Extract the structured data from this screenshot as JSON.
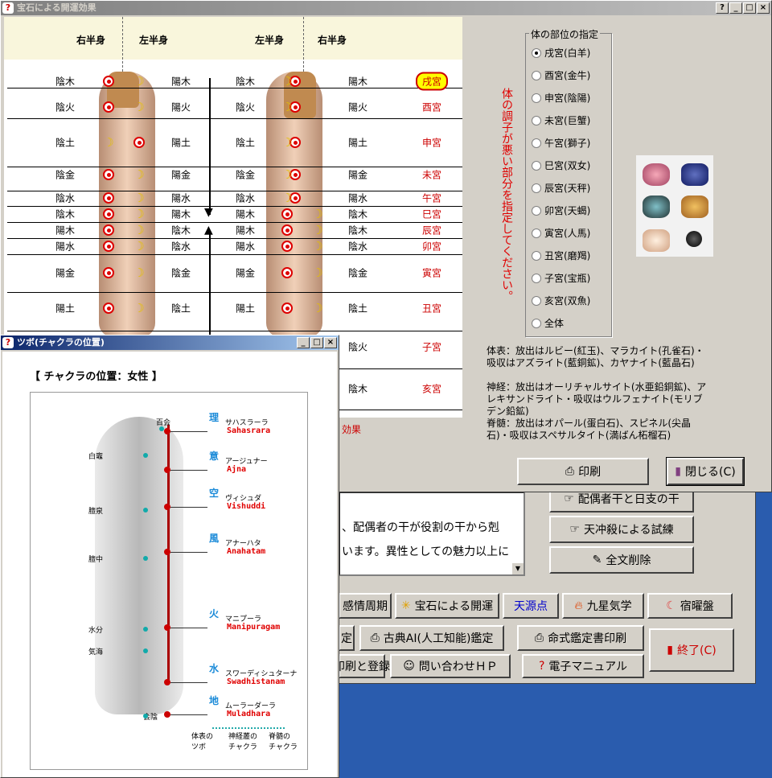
{
  "main": {
    "title": "宝石による開運効果",
    "close_label": "閉じる(C)",
    "print_label": "印刷"
  },
  "chart": {
    "headers": [
      "右半身",
      "左半身",
      "左半身",
      "右半身"
    ],
    "rows": [
      {
        "a": "陰木",
        "b": "陽木",
        "c": "陰木",
        "d": "陽木",
        "p": "戌宮"
      },
      {
        "a": "陰火",
        "b": "陽火",
        "c": "陰火",
        "d": "陽火",
        "p": "酉宮"
      },
      {
        "a": "陰土",
        "b": "陽土",
        "c": "陰土",
        "d": "陽土",
        "p": "申宮"
      },
      {
        "a": "陰金",
        "b": "陽金",
        "c": "陰金",
        "d": "陽金",
        "p": "未宮"
      },
      {
        "a": "陰水",
        "b": "陽水",
        "c": "陰水",
        "d": "陽水",
        "p": "午宮"
      },
      {
        "a": "陰木",
        "b": "陽木",
        "c": "陽木",
        "d": "陰木",
        "p": "巳宮"
      },
      {
        "a": "陽木",
        "b": "陰木",
        "c": "陽木",
        "d": "陰木",
        "p": "辰宮"
      },
      {
        "a": "陽水",
        "b": "陰水",
        "c": "陽水",
        "d": "陰水",
        "p": "卯宮"
      },
      {
        "a": "陽金",
        "b": "陰金",
        "c": "陽金",
        "d": "陰金",
        "p": "寅宮"
      },
      {
        "a": "陽土",
        "b": "陰土",
        "c": "陽土",
        "d": "陰土",
        "p": "丑宮"
      },
      {
        "a": "",
        "b": "",
        "c": "",
        "d": "陰火",
        "p": "子宮"
      },
      {
        "a": "",
        "b": "",
        "c": "",
        "d": "陰木",
        "p": "亥宮"
      }
    ],
    "fragment": "効果"
  },
  "instruction": "体の調子が悪い部分を指定してください。",
  "body_parts": {
    "legend": "体の部位の指定",
    "items": [
      "戌宮(白羊)",
      "酉宮(金牛)",
      "申宮(陰陽)",
      "未宮(巨蟹)",
      "午宮(獅子)",
      "巳宮(双女)",
      "辰宮(天秤)",
      "卯宮(天蝎)",
      "寅宮(人馬)",
      "丑宮(磨羯)",
      "子宮(宝瓶)",
      "亥宮(双魚)",
      "全体"
    ],
    "selected": 0
  },
  "desc": {
    "p1": "体表：放出はルビー(紅玉)、マラカイト(孔雀石)・吸収はアズライト(藍銅鉱)、カヤナイト(藍晶石)",
    "p2": "神経：放出はオーリチャルサイト(水亜鉛銅鉱)、アレキサンドライト・吸収はウルフェナイト(モリブデン鉛鉱)",
    "p3": "脊髄：放出はオパール(蛋白石)、スピネル(尖晶石)・吸収はスペサルタイト(満ばん柘榴石)"
  },
  "chakra": {
    "title": "ツボ(チャクラの位置)",
    "heading": "【 チャクラの位置：女性 】",
    "points": [
      {
        "kanji": "理",
        "kana": "サハスラーラ",
        "roman": "Sahasrara"
      },
      {
        "kanji": "意",
        "kana": "アージュナー",
        "roman": "Ajna"
      },
      {
        "kanji": "空",
        "kana": "ヴィシュダ",
        "roman": "Vishuddi"
      },
      {
        "kanji": "風",
        "kana": "アナーハタ",
        "roman": "Anahatam"
      },
      {
        "kanji": "火",
        "kana": "マニプーラ",
        "roman": "Manipuragam"
      },
      {
        "kanji": "水",
        "kana": "スワーディシュターナ",
        "roman": "Swadhistanam"
      },
      {
        "kanji": "地",
        "kana": "ムーラーダーラ",
        "roman": "Muladhara"
      }
    ],
    "points_left": [
      "百会",
      "白竈",
      "膻泉",
      "膻中",
      "水分",
      "気海",
      "会陰"
    ],
    "legend": [
      "体表の ツボ",
      "神経叢の チャクラ",
      "脊髄の チャクラ"
    ]
  },
  "back": {
    "text1": "、配偶者の干が役割の干から剋",
    "text2": "います。異性としての魅力以上に",
    "buttons": {
      "spouse": "配偶者干と日支の干",
      "tenchu": "天冲殺による試練",
      "clear": "全文削除",
      "bio": "感情周期",
      "gem": "宝石による開運",
      "tengen": "天源点",
      "kyusei": "九星気学",
      "shukuyo": "宿曜盤",
      "tei": "定",
      "ai": "古典AI(人工知能)鑑定",
      "meishiki": "命式鑑定書印刷",
      "register": "印刷と登録",
      "inquiry": "問い合わせＨＰ",
      "manual": "電子マニュアル",
      "exit": "終了(C)"
    }
  }
}
